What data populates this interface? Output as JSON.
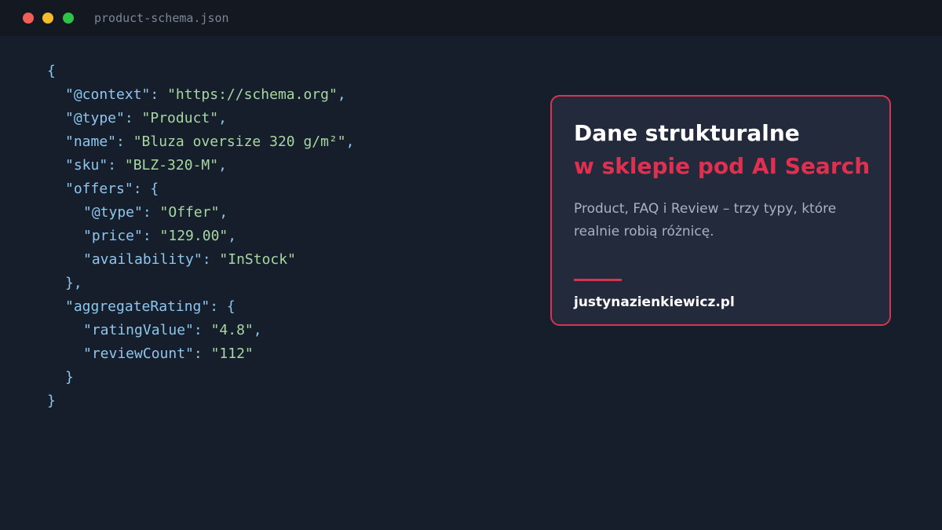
{
  "window": {
    "filename": "product-schema.json",
    "traffic_lights": {
      "close_color": "#f25f58",
      "minimize_color": "#f5bb2d",
      "maximize_color": "#2dc344"
    }
  },
  "code_lines": [
    {
      "indent": 0,
      "tokens": [
        [
          "punc",
          "{"
        ]
      ]
    },
    {
      "indent": 1,
      "tokens": [
        [
          "key",
          "\"@context\""
        ],
        [
          "punc",
          ": "
        ],
        [
          "str",
          "\"https://schema.org\""
        ],
        [
          "punc",
          ","
        ]
      ]
    },
    {
      "indent": 1,
      "tokens": [
        [
          "key",
          "\"@type\""
        ],
        [
          "punc",
          ": "
        ],
        [
          "str",
          "\"Product\""
        ],
        [
          "punc",
          ","
        ]
      ]
    },
    {
      "indent": 1,
      "tokens": [
        [
          "key",
          "\"name\""
        ],
        [
          "punc",
          ": "
        ],
        [
          "str",
          "\"Bluza oversize 320 g/m²\""
        ],
        [
          "punc",
          ","
        ]
      ]
    },
    {
      "indent": 1,
      "tokens": [
        [
          "key",
          "\"sku\""
        ],
        [
          "punc",
          ": "
        ],
        [
          "str",
          "\"BLZ-320-M\""
        ],
        [
          "punc",
          ","
        ]
      ]
    },
    {
      "indent": 1,
      "tokens": [
        [
          "key",
          "\"offers\""
        ],
        [
          "punc",
          ": {"
        ]
      ]
    },
    {
      "indent": 2,
      "tokens": [
        [
          "key",
          "\"@type\""
        ],
        [
          "punc",
          ": "
        ],
        [
          "str",
          "\"Offer\""
        ],
        [
          "punc",
          ","
        ]
      ]
    },
    {
      "indent": 2,
      "tokens": [
        [
          "key",
          "\"price\""
        ],
        [
          "punc",
          ": "
        ],
        [
          "str",
          "\"129.00\""
        ],
        [
          "punc",
          ","
        ]
      ]
    },
    {
      "indent": 2,
      "tokens": [
        [
          "key",
          "\"availability\""
        ],
        [
          "punc",
          ": "
        ],
        [
          "str",
          "\"InStock\""
        ]
      ]
    },
    {
      "indent": 1,
      "tokens": [
        [
          "punc",
          "},"
        ]
      ]
    },
    {
      "indent": 1,
      "tokens": [
        [
          "key",
          "\"aggregateRating\""
        ],
        [
          "punc",
          ": {"
        ]
      ]
    },
    {
      "indent": 2,
      "tokens": [
        [
          "key",
          "\"ratingValue\""
        ],
        [
          "punc",
          ": "
        ],
        [
          "str",
          "\"4.8\""
        ],
        [
          "punc",
          ","
        ]
      ]
    },
    {
      "indent": 2,
      "tokens": [
        [
          "key",
          "\"reviewCount\""
        ],
        [
          "punc",
          ": "
        ],
        [
          "str",
          "\"112\""
        ]
      ]
    },
    {
      "indent": 1,
      "tokens": [
        [
          "punc",
          "}"
        ]
      ]
    },
    {
      "indent": 0,
      "tokens": [
        [
          "punc",
          "}"
        ]
      ]
    }
  ],
  "card": {
    "title_line1": "Dane strukturalne",
    "title_line2": "w sklepie pod AI Search",
    "description": "Product, FAQ i Review – trzy typy, które realnie robią różnicę.",
    "url": "justynazienkiewicz.pl",
    "accent_color": "#e0304f"
  }
}
